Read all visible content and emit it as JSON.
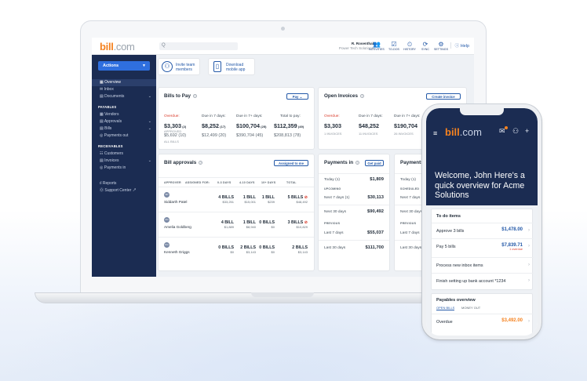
{
  "brand": {
    "logo_bill": "bill",
    "logo_com": ".com",
    "accent": "#f5821f",
    "navy": "#1b2c52",
    "blue": "#2459a8"
  },
  "topbar": {
    "search_placeholder": "Q",
    "user_name": "R. Rosenthal",
    "company": "Power Tech Solutions",
    "icons": [
      {
        "label": "ACTIVITIES",
        "glyph": "👥",
        "icon": "people-icon"
      },
      {
        "label": "TO-DOS",
        "glyph": "☑",
        "icon": "todo-icon"
      },
      {
        "label": "HISTORY",
        "glyph": "⏲",
        "icon": "history-icon"
      },
      {
        "label": "SYNC",
        "glyph": "⟳",
        "icon": "sync-icon"
      },
      {
        "label": "SETTINGS",
        "glyph": "⚙",
        "icon": "gear-icon"
      }
    ],
    "help": "Help"
  },
  "sidebar": {
    "actions": "Actions",
    "items": [
      {
        "label": "Overview",
        "selected": true
      },
      {
        "label": "Inbox"
      },
      {
        "label": "Documents",
        "chevron": true
      }
    ],
    "payables_header": "PAYABLES",
    "payables": [
      {
        "label": "Vendors"
      },
      {
        "label": "Approvals",
        "chevron": true
      },
      {
        "label": "Bills",
        "chevron": true
      },
      {
        "label": "Payments out"
      }
    ],
    "receivables_header": "RECEIVABLES",
    "receivables": [
      {
        "label": "Customers"
      },
      {
        "label": "Invoices",
        "chevron": true
      },
      {
        "label": "Payments in"
      }
    ],
    "bottom": [
      {
        "label": "Reports"
      },
      {
        "label": "Support Center"
      }
    ]
  },
  "promos": [
    {
      "line1": "Invite team",
      "line2": "members"
    },
    {
      "line1": "Download",
      "line2": "mobile app"
    }
  ],
  "bills_to_pay": {
    "title": "Bills to Pay",
    "button": "Pay",
    "columns": [
      "Overdue:",
      "Due in 7 days:",
      "Due in 7+ days:",
      "Total to pay:"
    ],
    "amounts": [
      {
        "value": "$3,303",
        "count": "(2)"
      },
      {
        "value": "$8,252",
        "count": "(17)"
      },
      {
        "value": "$100,704",
        "count": "(25)"
      },
      {
        "value": "$112,359",
        "count": "(49)"
      }
    ],
    "approved_label": "APPROVED",
    "second": [
      {
        "value": "$5,692",
        "count": "(10)"
      },
      {
        "value": "$12,499",
        "count": "(20)"
      },
      {
        "value": "$390,704",
        "count": "(45)"
      },
      {
        "value": "$208,813",
        "count": "(78)"
      }
    ],
    "all_label": "ALL BILLS"
  },
  "open_invoices": {
    "title": "Open Invoices",
    "button": "Create invoice",
    "columns": [
      "Overdue:",
      "Due in 7 days:",
      "Due in 7+ days:"
    ],
    "amounts": [
      "$3,303",
      "$48,252",
      "$190,704"
    ],
    "counts": [
      "1 INVOICES",
      "11 INVOICES",
      "26 INVOICES"
    ]
  },
  "bill_approvals": {
    "title": "Bill approvals",
    "button": "Assigned to me",
    "headers": [
      "APPROVER",
      "ASSIGNED FOR:",
      "0-3 DAYS",
      "4-10 DAYS",
      "10+ DAYS",
      "TOTAL"
    ],
    "rows": [
      {
        "initials": "SP",
        "name": "Siddarth Patel",
        "cells": [
          {
            "b": "4 BILLS",
            "a": "$33,251"
          },
          {
            "b": "1 BILL",
            "a": "$15,001"
          },
          {
            "b": "1 BILL",
            "a": "$239"
          },
          {
            "b": "5 BILLS",
            "a": "$48,492",
            "warn": true
          }
        ]
      },
      {
        "initials": "AG",
        "name": "Amelia Goldberg",
        "cells": [
          {
            "b": "4 BILL",
            "a": "$1,889"
          },
          {
            "b": "1 BILL",
            "a": "$8,940"
          },
          {
            "b": "0 BILLS",
            "a": "$0"
          },
          {
            "b": "3 BILLS",
            "a": "$10,829",
            "warn": true
          }
        ]
      },
      {
        "initials": "KG",
        "name": "Kenneth Griggs",
        "cells": [
          {
            "b": "0 BILLS",
            "a": "$0"
          },
          {
            "b": "2 BILLS",
            "a": "$3,143"
          },
          {
            "b": "0 BILLS",
            "a": "$0"
          },
          {
            "b": "2 BILLS",
            "a": "$3,143"
          }
        ]
      }
    ]
  },
  "payments_in": {
    "title": "Payments in",
    "button": "Get paid",
    "today_label": "Today (1)",
    "today_value": "$1,809",
    "upcoming": "UPCOMING",
    "upcoming_rows": [
      {
        "l": "Next 7 days (1)",
        "v": "$30,113"
      },
      {
        "l": "Next 30 days",
        "v": "$90,492"
      }
    ],
    "previous": "PREVIOUS",
    "previous_rows": [
      {
        "l": "Last 7 days",
        "v": "$55,037"
      },
      {
        "l": "Last 30 days",
        "v": "$111,700"
      }
    ]
  },
  "payments_out": {
    "title": "Payments",
    "today_label": "Today (1)",
    "scheduled": "SCHEDULED",
    "rows1": [
      "Next 7 days (1)",
      "Next 30 days"
    ],
    "previous": "PREVIOUS",
    "rows2": [
      "Last 7 days",
      "Last 30 days"
    ]
  },
  "phone": {
    "welcome": "Welcome, John Here's a quick overview for Acme Solutions",
    "todo_title": "To do items",
    "todos": [
      {
        "label": "Approve 3 bills",
        "value": "$1,478.00",
        "sub": ""
      },
      {
        "label": "Pay 5 bills",
        "value": "$7,839.71",
        "sub": "1 overdue"
      },
      {
        "label": "Process new inbox items",
        "value": "",
        "sub": ""
      },
      {
        "label": "Finish setting up bank account *1234",
        "value": "",
        "sub": ""
      }
    ],
    "payables_title": "Payables overview",
    "tabs": [
      "OPEN BILLS",
      "MONEY OUT"
    ],
    "overdue_label": "Overdue",
    "overdue_value": "$3,492.00"
  }
}
